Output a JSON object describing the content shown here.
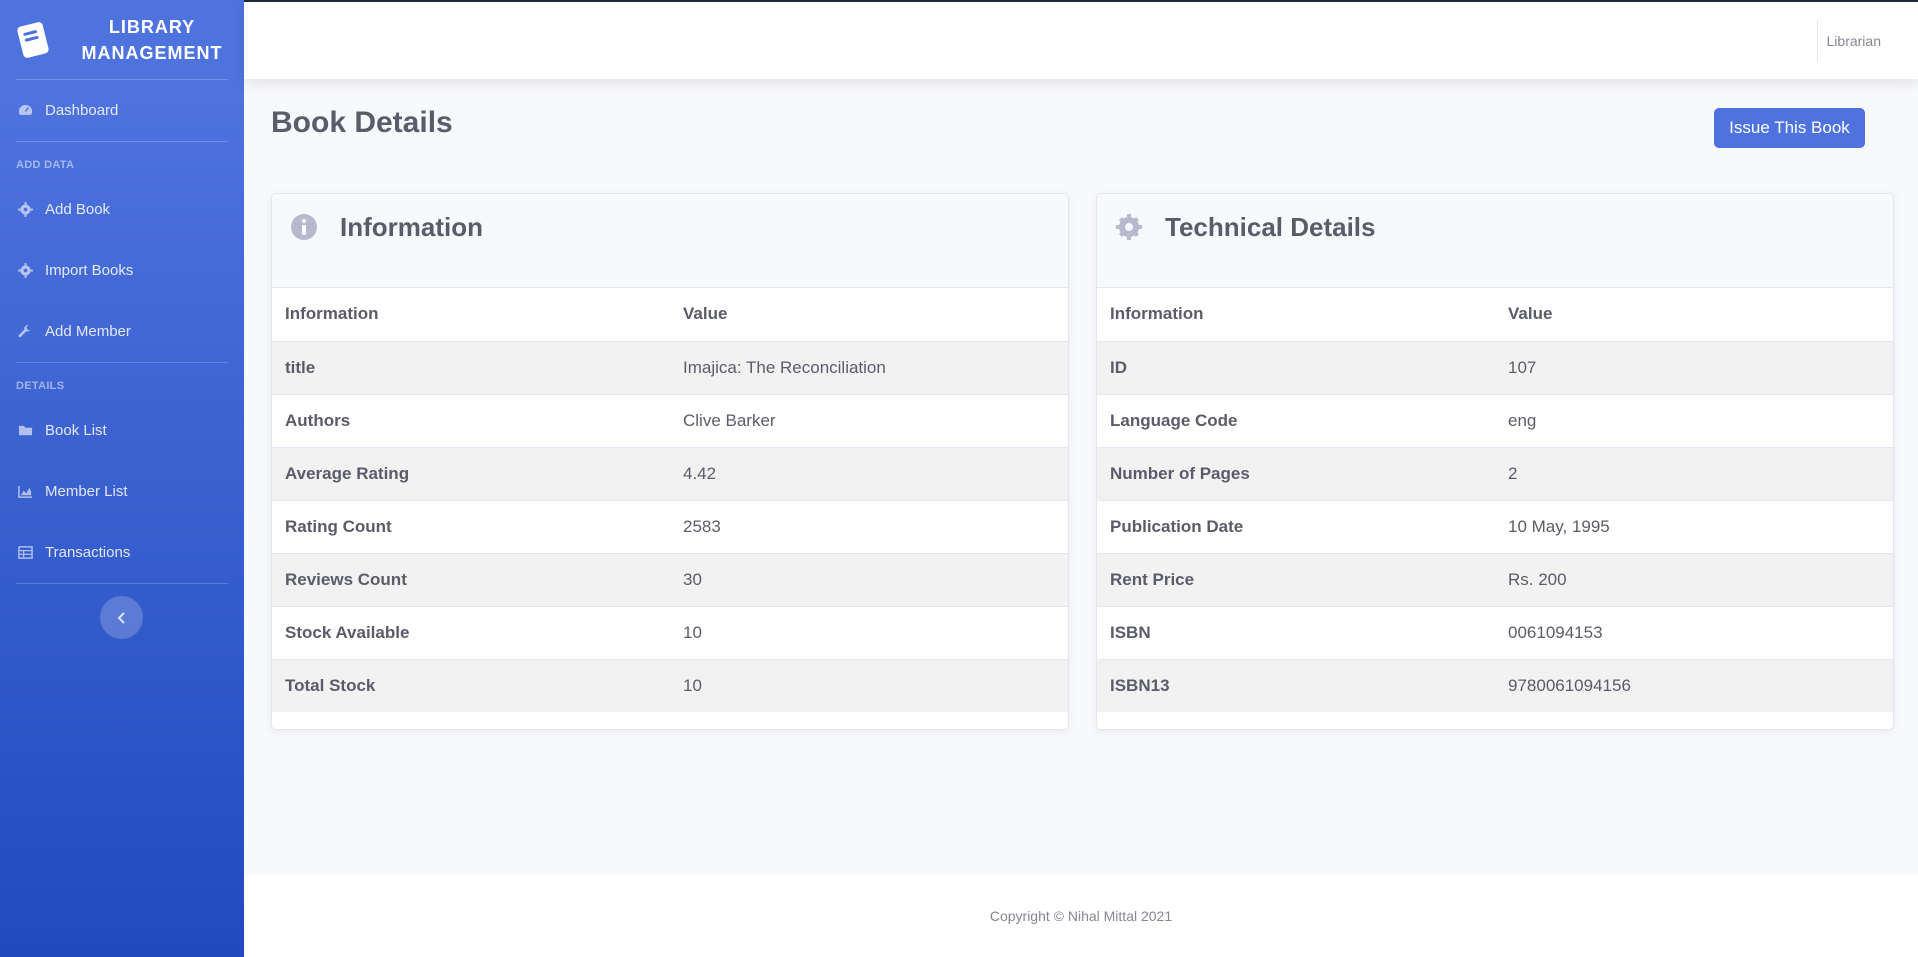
{
  "sidebar": {
    "brand": "LIBRARY MANAGEMENT",
    "items": {
      "dashboard": "Dashboard",
      "add_book": "Add Book",
      "import_books": "Import Books",
      "add_member": "Add Member",
      "book_list": "Book List",
      "member_list": "Member List",
      "transactions": "Transactions"
    },
    "headings": {
      "add_data": "ADD DATA",
      "details": "DETAILS"
    }
  },
  "topbar": {
    "user": "Librarian"
  },
  "page": {
    "title": "Book Details",
    "issue_button": "Issue This Book"
  },
  "information_card": {
    "title": "Information",
    "columns": [
      "Information",
      "Value"
    ],
    "rows": [
      [
        "title",
        "Imajica: The Reconciliation"
      ],
      [
        "Authors",
        "Clive Barker"
      ],
      [
        "Average Rating",
        "4.42"
      ],
      [
        "Rating Count",
        "2583"
      ],
      [
        "Reviews Count",
        "30"
      ],
      [
        "Stock Available",
        "10"
      ],
      [
        "Total Stock",
        "10"
      ]
    ]
  },
  "technical_card": {
    "title": "Technical Details",
    "columns": [
      "Information",
      "Value"
    ],
    "rows": [
      [
        "ID",
        "107"
      ],
      [
        "Language Code",
        "eng"
      ],
      [
        "Number of Pages",
        "2"
      ],
      [
        "Publication Date",
        "10 May, 1995"
      ],
      [
        "Rent Price",
        "Rs. 200"
      ],
      [
        "ISBN",
        "0061094153"
      ],
      [
        "ISBN13",
        "9780061094156"
      ]
    ]
  },
  "footer": {
    "copyright": "Copyright © Nihal Mittal 2021"
  },
  "colors": {
    "primary": "#4e73df",
    "sidebar_end": "#224abe",
    "text": "#5a5c69"
  },
  "icons": {
    "brand": "book-icon",
    "dashboard": "tachometer-icon",
    "add_book": "cog-icon",
    "import_books": "cog-icon",
    "add_member": "wrench-icon",
    "book_list": "folder-icon",
    "member_list": "chart-area-icon",
    "transactions": "table-icon",
    "toggle": "chevron-left-icon",
    "info": "info-circle-icon",
    "tech": "cog-icon"
  }
}
